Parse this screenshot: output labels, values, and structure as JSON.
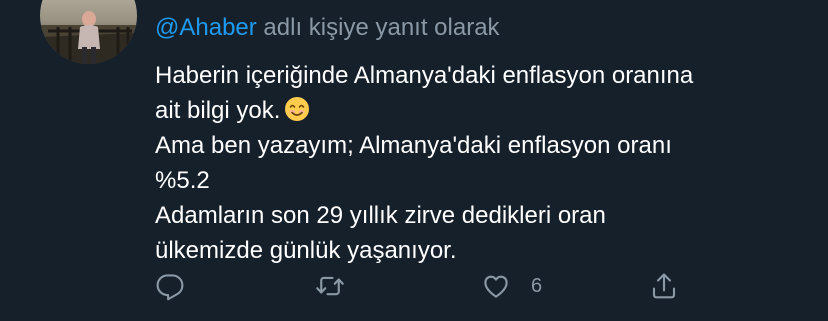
{
  "tweet": {
    "reply_context": {
      "mention": "@Ahaber",
      "suffix": " adlı kişiye yanıt olarak"
    },
    "paragraphs": [
      {
        "lines": [
          "Haberin içeriğinde Almanya'daki enflasyon oranına",
          "ait bilgi yok."
        ],
        "trailing_emoji": "smiling-face-emoji"
      },
      {
        "lines": [
          "Ama ben yazayım; Almanya'daki enflasyon oranı",
          "%5.2"
        ]
      },
      {
        "lines": [
          "Adamların son 29 yıllık zirve dedikleri oran",
          "ülkemizde günlük yaşanıyor."
        ]
      }
    ],
    "actions": {
      "reply_icon": "reply-icon",
      "retweet_icon": "retweet-icon",
      "like_icon": "heart-icon",
      "like_count": "6",
      "share_icon": "share-icon"
    }
  },
  "colors": {
    "background": "#15202b",
    "text": "#ffffff",
    "secondary": "#8b98a5",
    "accent": "#1d9bf0"
  }
}
